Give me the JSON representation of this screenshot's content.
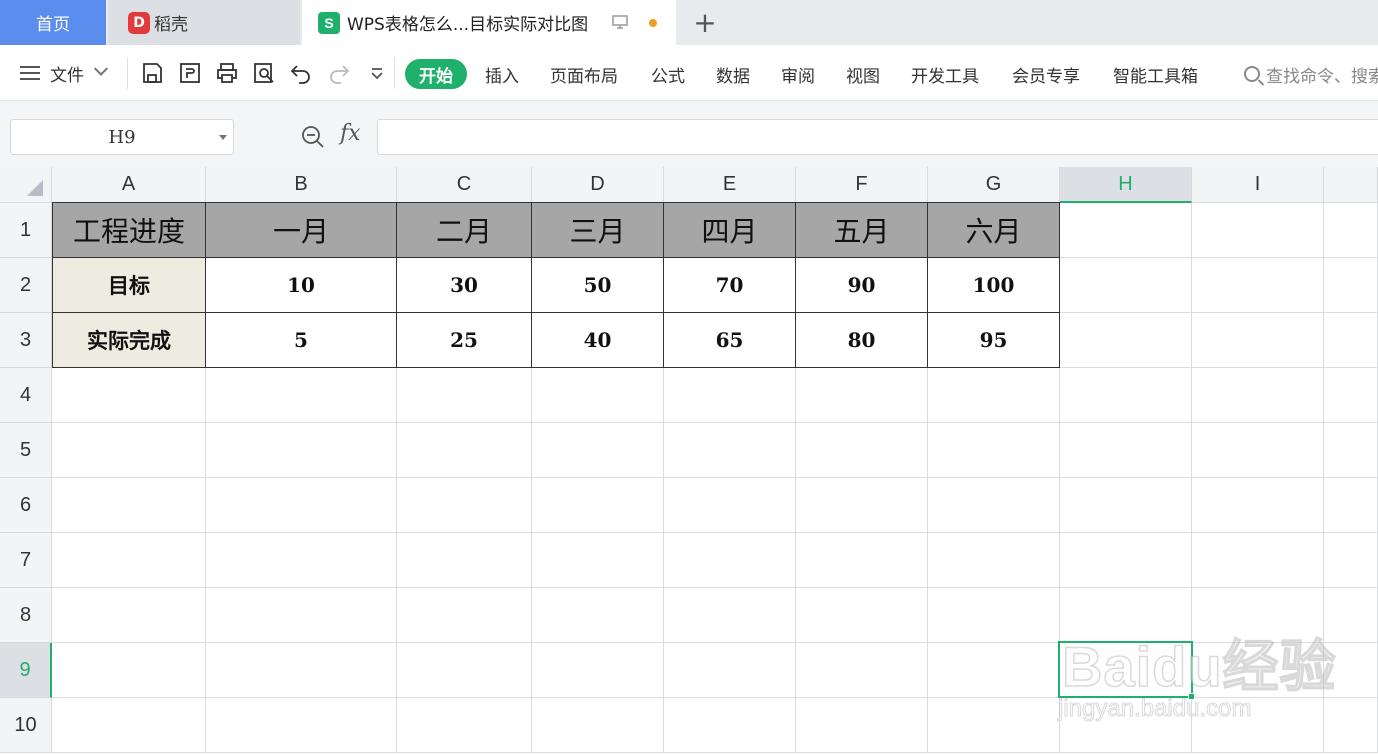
{
  "tabs": {
    "home": "首页",
    "daoke": "稻壳",
    "daoke_logo": "D",
    "doc_logo": "S",
    "doc_title": "WPS表格怎么...目标实际对比图",
    "add": "+"
  },
  "toolbar": {
    "file": "文件",
    "ribbon": [
      "开始",
      "插入",
      "页面布局",
      "公式",
      "数据",
      "审阅",
      "视图",
      "开发工具",
      "会员专享",
      "智能工具箱"
    ],
    "search_placeholder": "查找命令、搜索"
  },
  "formula_bar": {
    "name_box": "H9",
    "fx": "fx",
    "formula": ""
  },
  "grid": {
    "columns": [
      "A",
      "B",
      "C",
      "D",
      "E",
      "F",
      "G",
      "H",
      "I"
    ],
    "rows": [
      "1",
      "2",
      "3",
      "4",
      "5",
      "6",
      "7",
      "8",
      "9",
      "10"
    ],
    "selected_column": "H",
    "selected_row": "9",
    "table": {
      "header": [
        "工程进度",
        "一月",
        "二月",
        "三月",
        "四月",
        "五月",
        "六月"
      ],
      "rows": [
        [
          "目标",
          "10",
          "30",
          "50",
          "70",
          "90",
          "100"
        ],
        [
          "实际完成",
          "5",
          "25",
          "40",
          "65",
          "80",
          "95"
        ]
      ]
    }
  },
  "watermark": {
    "logo_text": "Baidu经验",
    "url": "jingyan.baidu.com"
  },
  "colors": {
    "accent": "#1fb06b",
    "home_tab": "#5b8def",
    "header_fill": "#a6a6a6",
    "label_fill": "#eeebe0"
  }
}
